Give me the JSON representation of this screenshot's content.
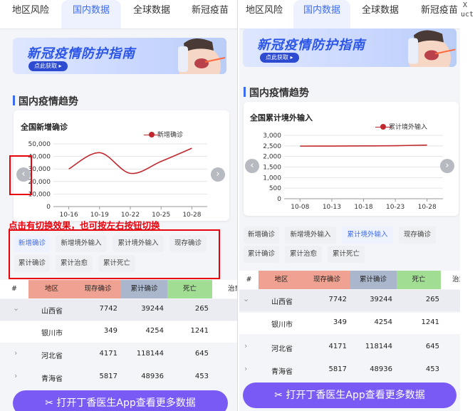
{
  "tabs": [
    "地区风险",
    "国内数据",
    "全球数据",
    "新冠疫苗"
  ],
  "active_tab": "国内数据",
  "banner": {
    "title": "新冠疫情防护指南",
    "cta": "点此获取 ▸"
  },
  "section_title": "国内疫情趋势",
  "left_chart_title": "全国新增确诊",
  "right_chart_title": "全国累计境外输入",
  "chips": [
    "新增确诊",
    "新增境外输入",
    "累计境外输入",
    "现存确诊",
    "累计确诊",
    "累计治愈",
    "累计死亡"
  ],
  "left_active_chip": "新增确诊",
  "right_active_chip": "累计境外输入",
  "annotation": "点击有切换效果，也可按左右按钮切换",
  "table": {
    "headers": [
      "#",
      "地区",
      "现存确诊",
      "累计确诊",
      "死亡",
      "治愈"
    ],
    "rows": [
      {
        "expand": "⌄",
        "region": "山西省",
        "current": "7742",
        "total": "39244",
        "death": "265"
      },
      {
        "expand": "",
        "region": "银川市",
        "current": "349",
        "total": "4254",
        "death": "1241"
      },
      {
        "expand": "›",
        "region": "河北省",
        "current": "4171",
        "total": "118144",
        "death": "645"
      },
      {
        "expand": "›",
        "region": "青海省",
        "current": "5817",
        "total": "48936",
        "death": "453"
      }
    ]
  },
  "bottom_button": "打开丁香医生App查看更多数据",
  "arrow_left": "‹",
  "arrow_right": "›",
  "right_edge_fragment": {
    "line1": "X",
    "line2": "uct"
  },
  "chart_data": [
    {
      "type": "line",
      "title": "全国新增确诊",
      "x": [
        "10-16",
        "10-19",
        "10-22",
        "10-25",
        "10-28"
      ],
      "series": [
        {
          "name": "新增确诊",
          "values": [
            30000,
            43000,
            26500,
            36000,
            46500
          ]
        }
      ],
      "ylim": [
        0,
        50000
      ],
      "yticks": [
        0,
        10000,
        20000,
        30000,
        40000,
        50000
      ],
      "ytick_labels": [
        "0",
        "10,000",
        "20,000",
        "30,000",
        "40,000",
        "50,000"
      ],
      "grid": true,
      "legend": "top-right",
      "color": "#c0282e"
    },
    {
      "type": "line",
      "title": "全国累计境外输入",
      "x": [
        "10-08",
        "10-13",
        "10-18",
        "10-23",
        "10-28"
      ],
      "series": [
        {
          "name": "累计境外输入",
          "values": [
            2490,
            2493,
            2500,
            2510,
            2540
          ]
        }
      ],
      "ylim": [
        0,
        3000
      ],
      "yticks": [
        0,
        500,
        1000,
        1500,
        2000,
        2500,
        3000
      ],
      "ytick_labels": [
        "0",
        "500",
        "1,000",
        "1,500",
        "2,000",
        "2,500",
        "3,000"
      ],
      "grid": true,
      "legend": "top-right",
      "color": "#c0282e"
    }
  ],
  "colors": {
    "accent": "#3d6cf0",
    "line": "#c0282e",
    "header_current": "#f0a292",
    "header_total": "#a9b6cc",
    "header_death": "#a2dd94",
    "button": "#7a5af5",
    "annotation": "#e8000b"
  }
}
